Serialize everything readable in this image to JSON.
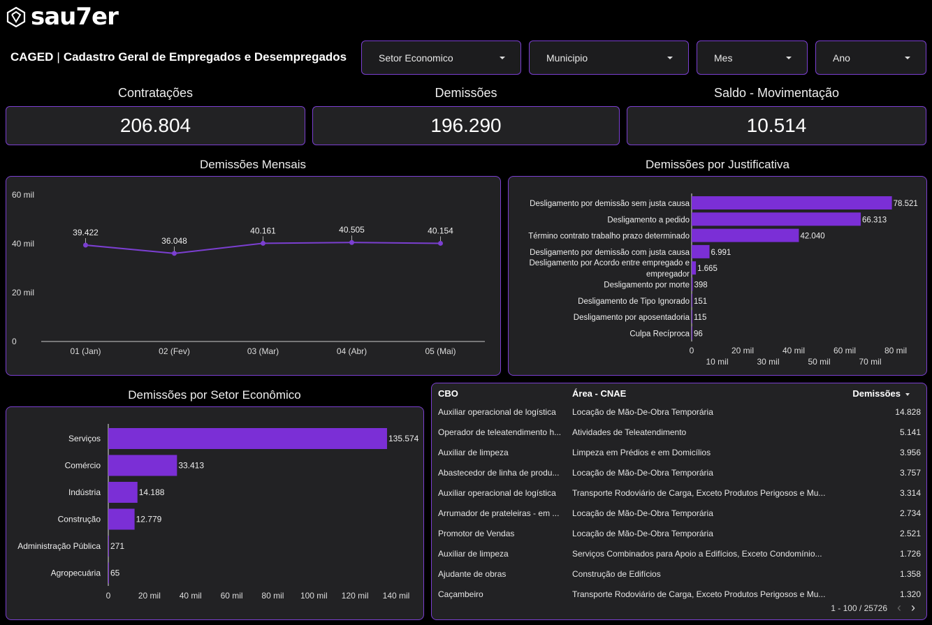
{
  "brand": {
    "name": "sau7er"
  },
  "header": {
    "title_short": "CAGED",
    "title_sep": "|",
    "title_long": "Cadastro Geral de Empregados e Desempregados"
  },
  "filters": [
    {
      "label": "Setor Economico"
    },
    {
      "label": "Municipio"
    },
    {
      "label": "Mes"
    },
    {
      "label": "Ano"
    }
  ],
  "kpis": [
    {
      "label": "Contratações",
      "value": "206.804"
    },
    {
      "label": "Demissões",
      "value": "196.290"
    },
    {
      "label": "Saldo - Movimentação",
      "value": "10.514"
    }
  ],
  "sections": {
    "monthly": "Demissões Mensais",
    "justification": "Demissões por Justificativa",
    "sector": "Demissões por Setor Econômico"
  },
  "chart_data": [
    {
      "type": "line",
      "title": "Demissões Mensais",
      "categories": [
        "01 (Jan)",
        "02 (Fev)",
        "03 (Mar)",
        "04 (Abr)",
        "05 (Mai)"
      ],
      "values": [
        39422,
        36048,
        40161,
        40505,
        40154
      ],
      "value_labels": [
        "39.422",
        "36.048",
        "40.161",
        "40.505",
        "40.154"
      ],
      "ylim": [
        0,
        60000
      ],
      "yticks": [
        0,
        20000,
        40000,
        60000
      ],
      "ytick_labels": [
        "0",
        "20 mil",
        "40 mil",
        "60 mil"
      ],
      "color": "#7b3fd1"
    },
    {
      "type": "bar",
      "orientation": "horizontal",
      "title": "Demissões por Justificativa",
      "categories": [
        [
          "Desligamento por demissão sem justa causa"
        ],
        [
          "Desligamento a pedido"
        ],
        [
          "Término contrato trabalho prazo determinado"
        ],
        [
          "Desligamento por demissão com justa causa"
        ],
        [
          "Desligamento por Acordo entre empregado e",
          "empregador"
        ],
        [
          "Desligamento por morte"
        ],
        [
          "Desligamento de Tipo Ignorado"
        ],
        [
          "Desligamento por aposentadoria"
        ],
        [
          "Culpa Recíproca"
        ]
      ],
      "values": [
        78521,
        66313,
        42040,
        6991,
        1665,
        398,
        151,
        115,
        96
      ],
      "value_labels": [
        "78.521",
        "66.313",
        "42.040",
        "6.991",
        "1.665",
        "398",
        "151",
        "115",
        "96"
      ],
      "xlim": [
        0,
        80000
      ],
      "xticks_top": [
        0,
        20000,
        40000,
        60000,
        80000
      ],
      "xtick_labels_top": [
        "0",
        "20 mil",
        "40 mil",
        "60 mil",
        "80 mil"
      ],
      "xticks_bottom": [
        10000,
        30000,
        50000,
        70000
      ],
      "xtick_labels_bottom": [
        "10 mil",
        "30 mil",
        "50 mil",
        "70 mil"
      ],
      "color": "#7b2fd6"
    },
    {
      "type": "bar",
      "orientation": "horizontal",
      "title": "Demissões por Setor Econômico",
      "categories": [
        "Serviços",
        "Comércio",
        "Indústria",
        "Construção",
        "Administração Pública",
        "Agropecuária"
      ],
      "values": [
        135574,
        33413,
        14188,
        12779,
        271,
        65
      ],
      "value_labels": [
        "135.574",
        "33.413",
        "14.188",
        "12.779",
        "271",
        "65"
      ],
      "xlim": [
        0,
        140000
      ],
      "xticks": [
        0,
        20000,
        40000,
        60000,
        80000,
        100000,
        120000,
        140000
      ],
      "xtick_labels": [
        "0",
        "20 mil",
        "40 mil",
        "60 mil",
        "80 mil",
        "100 mil",
        "120 mil",
        "140 mil"
      ],
      "color": "#7b2fd6"
    }
  ],
  "table": {
    "columns": [
      "CBO",
      "Área - CNAE",
      "Demissões"
    ],
    "rows": [
      [
        "Auxiliar operacional de logística",
        "Locação de Mão-De-Obra Temporária",
        "14.828"
      ],
      [
        "Operador de teleatendimento h...",
        "Atividades de Teleatendimento",
        "5.141"
      ],
      [
        "Auxiliar de limpeza",
        "Limpeza em Prédios e em Domicílios",
        "3.956"
      ],
      [
        "Abastecedor de linha de produ...",
        "Locação de Mão-De-Obra Temporária",
        "3.757"
      ],
      [
        "Auxiliar operacional de logística",
        "Transporte Rodoviário de Carga, Exceto Produtos Perigosos e Mu...",
        "3.314"
      ],
      [
        "Arrumador de prateleiras - em ...",
        "Locação de Mão-De-Obra Temporária",
        "2.734"
      ],
      [
        "Promotor de Vendas",
        "Locação de Mão-De-Obra Temporária",
        "2.521"
      ],
      [
        "Auxiliar de limpeza",
        "Serviços Combinados para Apoio a Edifícios, Exceto Condomínio...",
        "1.726"
      ],
      [
        "Ajudante de obras",
        "Construção de Edifícios",
        "1.358"
      ],
      [
        "Caçambeiro",
        "Transporte Rodoviário de Carga, Exceto Produtos Perigosos e Mu...",
        "1.320"
      ]
    ],
    "pagination": "1 - 100 / 25726",
    "prev_icon": "‹",
    "next_icon": "›"
  }
}
